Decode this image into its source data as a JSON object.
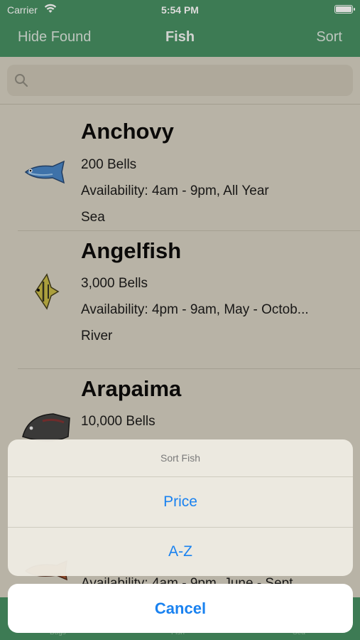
{
  "status_bar": {
    "carrier": "Carrier",
    "time": "5:54 PM"
  },
  "nav": {
    "left_button": "Hide Found",
    "title": "Fish",
    "right_button": "Sort"
  },
  "search": {
    "placeholder": ""
  },
  "fish": [
    {
      "name": "Anchovy",
      "price": "200 Bells",
      "availability": "Availability: 4am - 9pm, All Year",
      "location": "Sea",
      "icon": "anchovy-icon"
    },
    {
      "name": "Angelfish",
      "price": "3,000 Bells",
      "availability": "Availability: 4pm - 9am, May - Octob...",
      "location": "River",
      "icon": "angelfish-icon"
    },
    {
      "name": "Arapaima",
      "price": "10,000 Bells",
      "availability": "",
      "location": "",
      "icon": "arapaima-icon"
    },
    {
      "name": "",
      "price": "",
      "availability": "Availability: 4am - 9pm, June - Sept...",
      "location": "",
      "icon": "arowana-icon"
    }
  ],
  "tabs": [
    {
      "label": "Bugs"
    },
    {
      "label": "Fish"
    },
    {
      "label": "Sea"
    }
  ],
  "action_sheet": {
    "title": "Sort Fish",
    "options": [
      "Price",
      "A-Z"
    ],
    "cancel": "Cancel"
  },
  "colors": {
    "nav_green": "#3d8a5c",
    "background": "#d3cfc0",
    "action_blue": "#1a82f0"
  }
}
